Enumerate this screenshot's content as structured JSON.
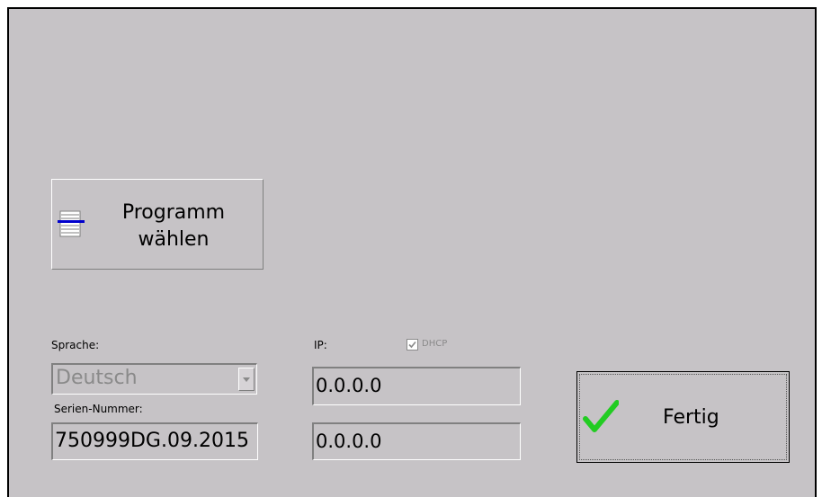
{
  "program_button": {
    "label": "Programm\nwählen",
    "icon": "list-icon"
  },
  "language": {
    "label": "Sprache:",
    "selected": "Deutsch"
  },
  "serial": {
    "label": "Serien-Nummer:",
    "value": "750999DG.09.2015"
  },
  "ip": {
    "label": "IP:",
    "dhcp_label": "DHCP",
    "dhcp_checked": true,
    "address": "0.0.0.0",
    "second": "0.0.0.0"
  },
  "done_button": {
    "label": "Fertig",
    "icon": "checkmark-icon"
  },
  "colors": {
    "background": "#c6c3c6",
    "check_green": "#22cc22",
    "list_blue": "#0000cc"
  }
}
